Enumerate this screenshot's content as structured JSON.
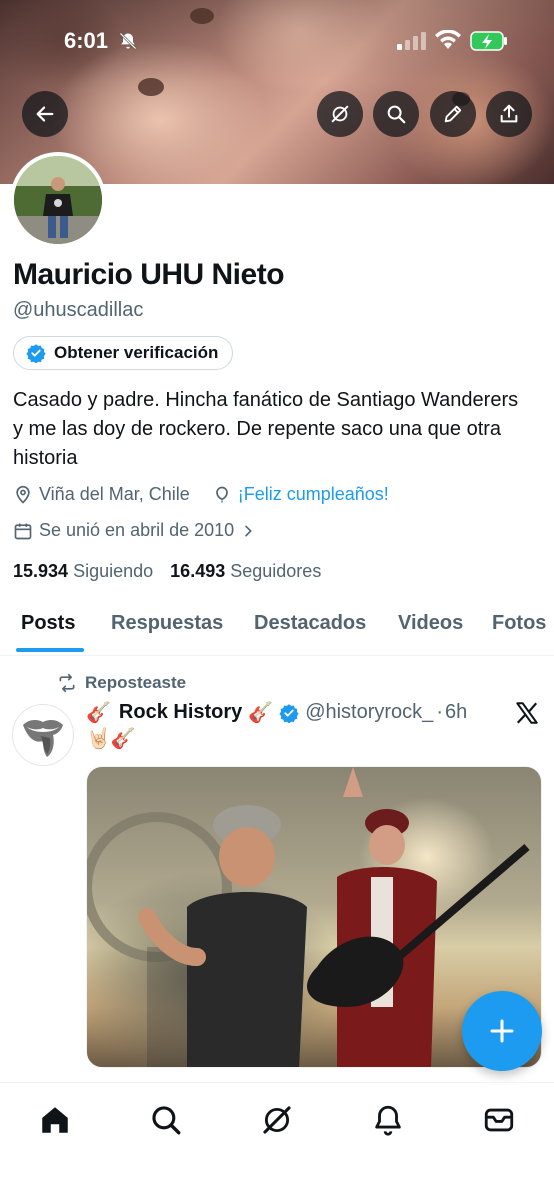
{
  "status_bar": {
    "time": "6:01"
  },
  "header_buttons": [
    "back-button",
    "grok-button",
    "search-button",
    "edit-button",
    "share-button"
  ],
  "profile": {
    "name": "Mauricio UHU Nieto",
    "handle": "@uhuscadillac",
    "verify_label": "Obtener verificación",
    "bio": "Casado y padre. Hincha fanático de Santiago Wanderers y me las doy de rockero. De repente saco una que otra historia",
    "location": "Viña del Mar, Chile",
    "birthday": "¡Feliz cumpleaños!",
    "joined": "Se unió en abril de 2010",
    "following_count": "15.934",
    "following_label": "Siguiendo",
    "followers_count": "16.493",
    "followers_label": "Seguidores"
  },
  "tabs": [
    {
      "label": "Posts",
      "active": true
    },
    {
      "label": "Respuestas",
      "active": false
    },
    {
      "label": "Destacados",
      "active": false
    },
    {
      "label": "Videos",
      "active": false
    },
    {
      "label": "Fotos",
      "active": false
    }
  ],
  "post": {
    "repost_label": "Reposteaste",
    "author_prefix": "🎸",
    "author_name": "Rock History",
    "author_suffix": "🎸",
    "author_handle": "@historyrock_",
    "separator": "·",
    "time": "6h",
    "second_line": "🤘🏻🎸"
  },
  "bottom_nav": [
    "home-icon",
    "search-icon",
    "grok-icon",
    "bell-icon",
    "mail-icon"
  ],
  "colors": {
    "accent": "#1d9bf0",
    "text": "#0f1419",
    "secondary": "#536471"
  }
}
